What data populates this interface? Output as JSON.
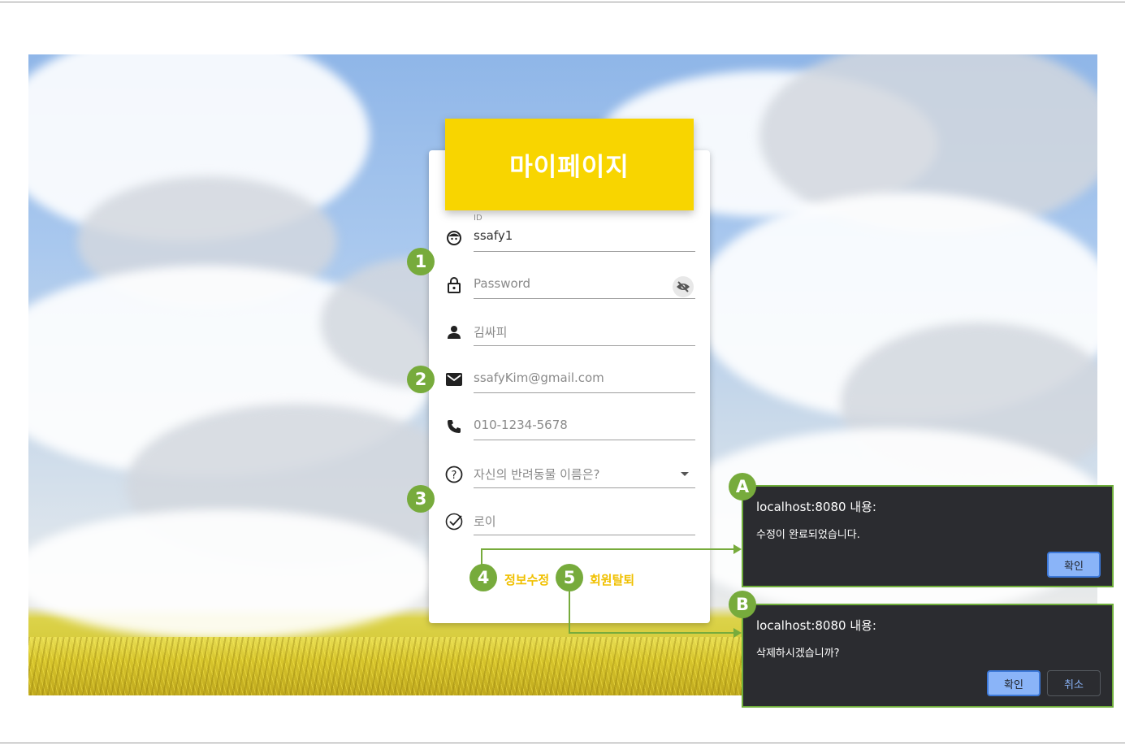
{
  "page": {
    "title": "마이페이지"
  },
  "form": {
    "id_label": "ID",
    "id_value": "ssafy1",
    "password_placeholder": "Password",
    "name_value": "김싸피",
    "email_value": "ssafyKim@gmail.com",
    "phone_value": "010-1234-5678",
    "question_value": "자신의 반려동물 이름은?",
    "answer_value": "로이"
  },
  "actions": {
    "update_label": "정보수정",
    "delete_label": "회원탈퇴"
  },
  "callouts": {
    "b1": "1",
    "b2": "2",
    "b3": "3",
    "b4": "4",
    "b5": "5",
    "bA": "A",
    "bB": "B"
  },
  "dialog_a": {
    "title": "localhost:8080 내용:",
    "message": "수정이 완료되었습니다.",
    "ok_label": "확인"
  },
  "dialog_b": {
    "title": "localhost:8080 내용:",
    "message": "삭제하시겠습니까?",
    "ok_label": "확인",
    "cancel_label": "취소"
  },
  "colors": {
    "banner": "#f8d500",
    "accent_text": "#f0c000",
    "callout": "#77ab3c",
    "dialog_bg": "#2b2c30",
    "dialog_primary": "#8ab4f8"
  },
  "icons": [
    "face-icon",
    "lock-icon",
    "eye-off-icon",
    "person-icon",
    "mail-icon",
    "phone-icon",
    "question-icon",
    "check-circle-icon",
    "dropdown-caret-icon"
  ]
}
